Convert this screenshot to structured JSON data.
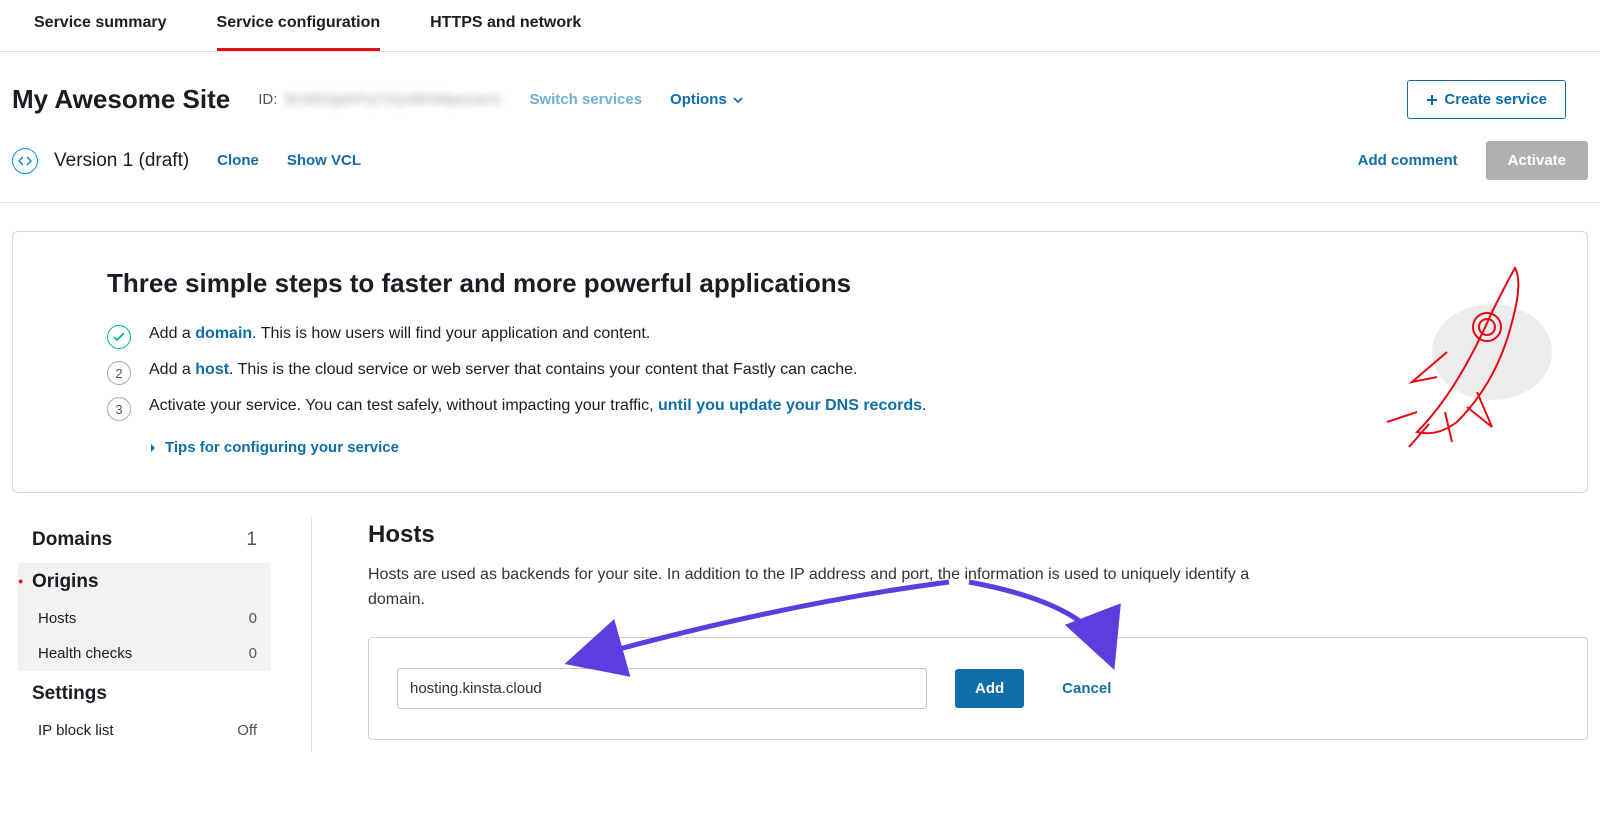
{
  "tabs": [
    "Service summary",
    "Service configuration",
    "HTTPS and network"
  ],
  "active_tab": 1,
  "header": {
    "site_title": "My Awesome Site",
    "id_label": "ID:",
    "id_value": "8cW5QphPq7XQ48HMpesarm",
    "switch": "Switch services",
    "options": "Options",
    "create": "Create service"
  },
  "version": {
    "label": "Version 1 (draft)",
    "clone": "Clone",
    "show_vcl": "Show VCL",
    "add_comment": "Add comment",
    "activate": "Activate"
  },
  "steps": {
    "title": "Three simple steps to faster and more powerful applications",
    "s1_pre": "Add a ",
    "s1_link": "domain",
    "s1_post": ". This is how users will find your application and content.",
    "s2_pre": "Add a ",
    "s2_link": "host",
    "s2_post": ". This is the cloud service or web server that contains your content that Fastly can cache.",
    "s3_pre": "Activate your service. You can test safely, without impacting your traffic, ",
    "s3_link": "until you update your DNS records",
    "s3_post": ".",
    "tips": "Tips for configuring your service"
  },
  "sidebar": {
    "domains": {
      "label": "Domains",
      "count": "1"
    },
    "origins_title": "Origins",
    "hosts": {
      "label": "Hosts",
      "count": "0"
    },
    "health": {
      "label": "Health checks",
      "count": "0"
    },
    "settings_title": "Settings",
    "ip_block": {
      "label": "IP block list",
      "value": "Off"
    }
  },
  "main": {
    "hosts_title": "Hosts",
    "hosts_desc": "Hosts are used as backends for your site. In addition to the IP address and port, the information is used to uniquely identify a domain.",
    "host_input": "hosting.kinsta.cloud",
    "add": "Add",
    "cancel": "Cancel"
  }
}
